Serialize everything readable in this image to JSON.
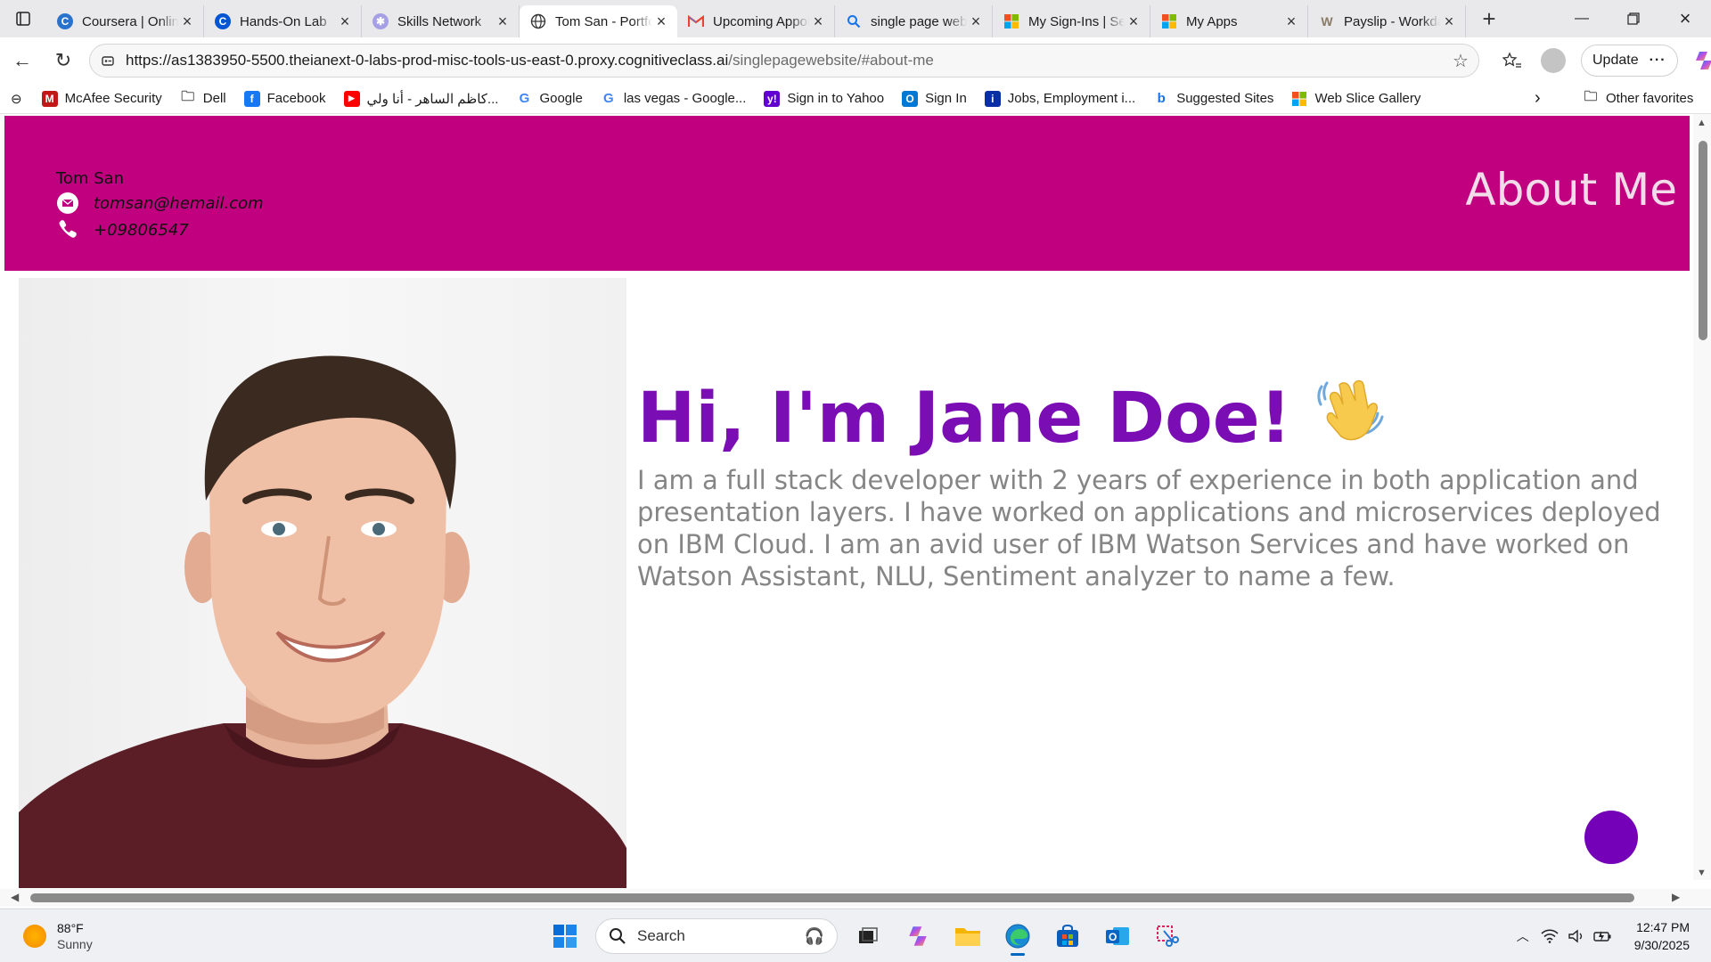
{
  "browser": {
    "tabs": [
      {
        "label": "Coursera | Online Courses",
        "icon": "coursera-icon",
        "active": false
      },
      {
        "label": "Hands-On Lab",
        "icon": "coursera-icon",
        "active": false
      },
      {
        "label": "Skills Network",
        "icon": "skills-network-icon",
        "active": false
      },
      {
        "label": "Tom San - Portfolio",
        "icon": "globe-icon",
        "active": true
      },
      {
        "label": "Upcoming Appointments",
        "icon": "gmail-icon",
        "active": false
      },
      {
        "label": "single page website",
        "icon": "search-icon",
        "active": false
      },
      {
        "label": "My Sign-Ins | Security",
        "icon": "microsoft-icon",
        "active": false
      },
      {
        "label": "My Apps",
        "icon": "microsoft-icon",
        "active": false
      },
      {
        "label": "Payslip - Workday",
        "icon": "workday-icon",
        "active": false
      }
    ],
    "url_main": "https://as1383950-5500.theianext-0-labs-prod-misc-tools-us-east-0.proxy.cognitiveclass.ai",
    "url_path": "/singlepagewebsite/#about-me",
    "update_label": "Update",
    "favorites": [
      {
        "label": "McAfee Security",
        "icon": "mcafee-icon",
        "color": "#c01818"
      },
      {
        "label": "Dell",
        "icon": "folder-icon",
        "color": "#555555"
      },
      {
        "label": "Facebook",
        "icon": "facebook-icon",
        "color": "#1877f2"
      },
      {
        "label": "كاظم الساهر - أنا ولي...",
        "icon": "youtube-icon",
        "color": "#ff0000"
      },
      {
        "label": "Google",
        "icon": "google-icon",
        "color": "#4285f4"
      },
      {
        "label": "las vegas - Google...",
        "icon": "google-icon",
        "color": "#4285f4"
      },
      {
        "label": "Sign in to Yahoo",
        "icon": "yahoo-icon",
        "color": "#6001d2"
      },
      {
        "label": "Sign In",
        "icon": "outlook-icon",
        "color": "#0078d4"
      },
      {
        "label": "Jobs, Employment i...",
        "icon": "jobs-icon",
        "color": "#0a2ea4"
      },
      {
        "label": "Suggested Sites",
        "icon": "bing-icon",
        "color": "#1a73e8"
      },
      {
        "label": "Web Slice Gallery",
        "icon": "windows-icon",
        "color": "#f25022"
      }
    ],
    "other_favorites": "Other favorites"
  },
  "page": {
    "header": {
      "name": "Tom San",
      "email": "tomsan@hemail.com",
      "phone": "+09806547",
      "section_title": "About Me"
    },
    "greeting": "Hi, I'm Jane Doe!",
    "wave_emoji": "👋",
    "bio": "I am a full stack developer with 2 years of experience in both application and presentation layers. I have worked on applications and microservices deployed on IBM Cloud. I am an avid user of IBM Watson Services and have worked on Watson Assistant, NLU, Sentiment analyzer to name a few.",
    "accent_color": "#c0007e",
    "greeting_color": "#7a0db3"
  },
  "taskbar": {
    "weather_temp": "88°F",
    "weather_cond": "Sunny",
    "search_placeholder": "Search",
    "time": "12:47 PM",
    "date": "9/30/2025"
  }
}
